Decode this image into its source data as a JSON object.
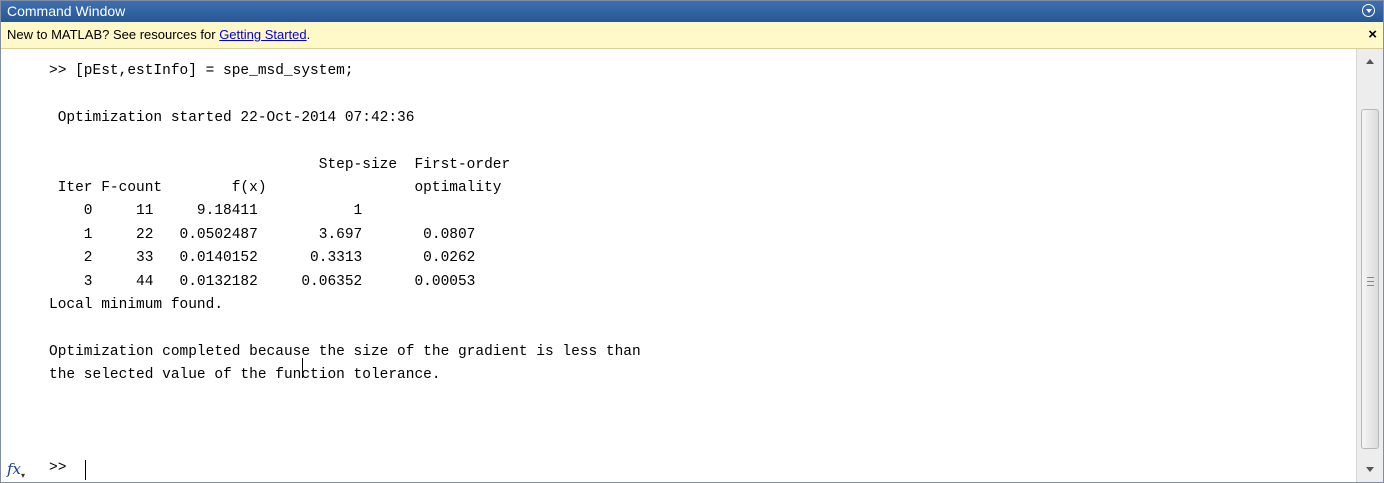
{
  "window": {
    "title": "Command Window"
  },
  "infobar": {
    "prefix": "New to MATLAB? See resources for ",
    "link": "Getting Started",
    "suffix": ".",
    "close_label": "×"
  },
  "console": {
    "output": ">> [pEst,estInfo] = spe_msd_system;\n\n Optimization started 22-Oct-2014 07:42:36\n\n                               Step-size  First-order\n Iter F-count        f(x)                 optimality\n    0     11     9.18411           1\n    1     22   0.0502487       3.697       0.0807\n    2     33   0.0140152      0.3313       0.0262\n    3     44   0.0132182     0.06352      0.00053\nLocal minimum found.\n\nOptimization completed because the size of the gradient is less than\nthe selected value of the function tolerance.",
    "prompt": ">>",
    "fx_icon_label": "fx",
    "fx_arrow": "▾"
  },
  "icons": {
    "title_menu": "chevron-circle-down-icon",
    "close": "close-icon",
    "fx": "function-browser-icon"
  },
  "colors": {
    "titlebar": "#2c5f9f",
    "infobar_bg": "#fff8c9",
    "link": "#0000ee"
  }
}
